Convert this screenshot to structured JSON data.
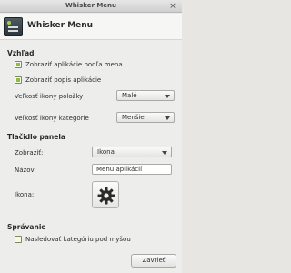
{
  "window": {
    "title": "Whisker Menu",
    "close_glyph": "×"
  },
  "header": {
    "heading": "Whisker Menu",
    "icon": "whisker-menu-icon"
  },
  "appearance": {
    "title": "Vzhľad",
    "show_names": {
      "label": "Zobraziť aplikácie podľa mena",
      "checked": true
    },
    "show_descriptions": {
      "label": "Zobraziť popis aplikácie",
      "checked": true
    },
    "item_icon_size": {
      "label": "Veľkosť ikony položky",
      "value": "Malé"
    },
    "category_icon_size": {
      "label": "Veľkosť ikony kategorie",
      "value": "Menšie"
    }
  },
  "panel_button": {
    "title": "Tlačidlo panela",
    "display": {
      "label": "Zobraziť:",
      "value": "Ikona"
    },
    "name": {
      "label": "Názov:",
      "value": "Menu aplikácií"
    },
    "icon": {
      "label": "Ikona:",
      "icon": "gear-icon"
    }
  },
  "behavior": {
    "title": "Správanie",
    "follow_pointer": {
      "label": "Nasledovať kategóriu pod myšou",
      "checked": false
    }
  },
  "footer": {
    "close_label": "Zavrieť"
  },
  "colors": {
    "accent": "#8dbd3c",
    "check_border": "#7a8a5a"
  }
}
